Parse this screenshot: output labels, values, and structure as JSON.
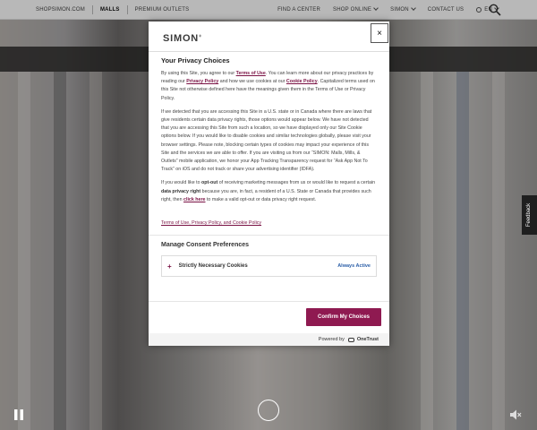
{
  "topnav": {
    "left_links": [
      "SHOPSIMON.COM",
      "MALLS",
      "PREMIUM OUTLETS"
    ],
    "right_links": [
      "FIND A CENTER",
      "SHOP ONLINE",
      "SIMON",
      "CONTACT US"
    ],
    "language": "EN"
  },
  "modal": {
    "logo": "SIMON",
    "close": "×",
    "title": "Your Privacy Choices",
    "p1": {
      "t1": "By using this Site, you agree to our ",
      "l1": "Terms of Use",
      "t2": ". You can learn more about our privacy practices by reading our ",
      "l2": "Privacy Policy",
      "t3": " and how we use cookies at our ",
      "l3": "Cookie Policy",
      "t4": ". Capitalized terms used on this Site not otherwise defined here have the meanings given them in the Terms of Use or Privacy Policy."
    },
    "p2": "If we detected that you are accessing this Site in a U.S. state or in Canada where there are laws that give residents certain data privacy rights, those options would appear below. We have not detected that you are accessing this Site from such a location, so we have displayed only our Site Cookie options below. If you would like to disable cookies and similar technologies globally, please visit your browser settings. Please note, blocking certain types of cookies may impact your experience of this Site and the services we are able to offer. If you are visiting us from our “SIMON: Malls, Mills, & Outlets” mobile application, we honor your App Tracking Transparency request for “Ask App Not To Track” on iOS and do not track or share your advertising identifier (IDFA).",
    "p3": {
      "t1": "If you would like to ",
      "b1": "opt-out",
      "t2": " of receiving marketing messages from us or would like to request a certain ",
      "b2": "data privacy right",
      "t3": " because you are, in fact, a resident of a U.S. State or Canada that provides such right, then ",
      "l1": "click here",
      "t4": " to make a valid opt-out or data privacy right request."
    },
    "policy_link": "Terms of Use, Privacy Policy, and Cookie Policy",
    "manage_heading": "Manage Consent Preferences",
    "consent_label": "Strictly Necessary Cookies",
    "consent_status": "Always Active",
    "confirm_button": "Confirm My Choices",
    "powered_by": "Powered by",
    "powered_brand": "OneTrust"
  },
  "feedback_tab": "Feedback",
  "colors": {
    "accent": "#8f1a51",
    "link": "#7a1244",
    "status": "#2b5fa8"
  }
}
